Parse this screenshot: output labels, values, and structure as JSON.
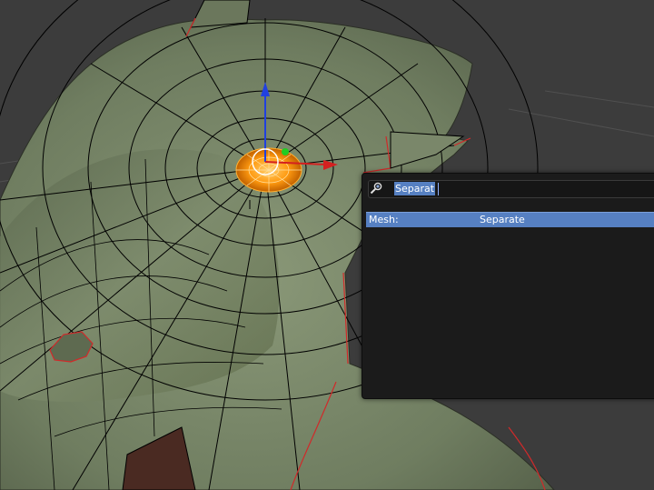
{
  "app": "Blender 3D Viewport",
  "viewport": {
    "mode": "Edit Mode",
    "mesh_color": "#6d7a5e",
    "wire_color": "#000000",
    "seam_color": "#d02a2a",
    "selection_color": "#ff8a00",
    "gizmo": {
      "x_axis_color": "#d42020",
      "y_axis_color": "#22cc22",
      "z_axis_color": "#2040e0"
    }
  },
  "search_menu": {
    "query": "Separat",
    "results": [
      {
        "category": "Mesh:",
        "name": "Separate",
        "selected": true
      }
    ]
  }
}
